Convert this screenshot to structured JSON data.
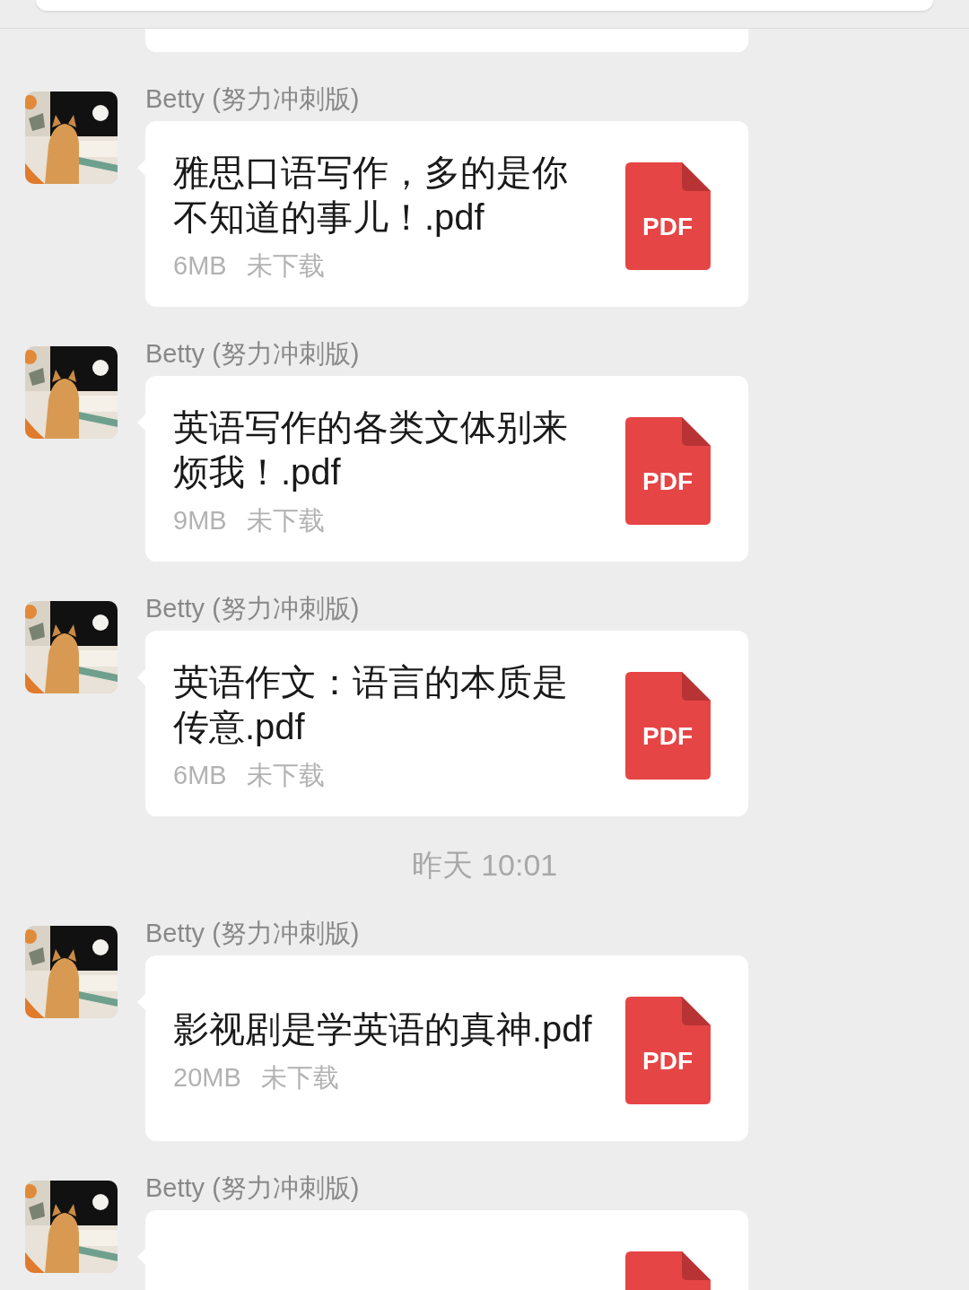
{
  "messages": [
    {
      "kind": "file",
      "sender": "Betty (努力冲刺版)",
      "title": "雅思口语写作，多的是你不知道的事儿！.pdf",
      "size": "6MB",
      "status": "未下载",
      "file_type": "PDF"
    },
    {
      "kind": "file",
      "sender": "Betty (努力冲刺版)",
      "title": "英语写作的各类文体别来烦我！.pdf",
      "size": "9MB",
      "status": "未下载",
      "file_type": "PDF"
    },
    {
      "kind": "file",
      "sender": "Betty (努力冲刺版)",
      "title": "英语作文：语言的本质是传意.pdf",
      "size": "6MB",
      "status": "未下载",
      "file_type": "PDF"
    },
    {
      "kind": "time",
      "text": "昨天 10:01"
    },
    {
      "kind": "file",
      "sender": "Betty (努力冲刺版)",
      "title": "影视剧是学英语的真神.pdf",
      "size": "20MB",
      "status": "未下载",
      "file_type": "PDF"
    },
    {
      "kind": "file",
      "sender": "Betty (努力冲刺版)"
    }
  ]
}
